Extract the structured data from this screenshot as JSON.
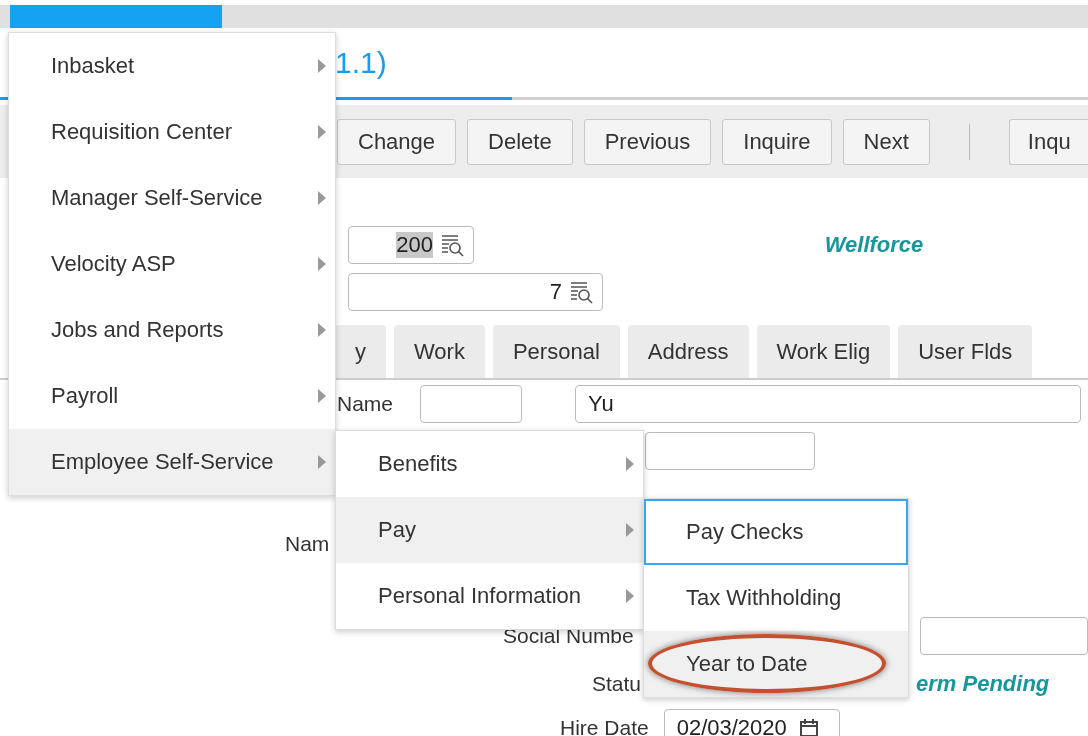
{
  "title_fragment": "1.1)",
  "toolbar": [
    "Change",
    "Delete",
    "Previous",
    "Inquire",
    "Next"
  ],
  "toolbar_cut": "Inqu",
  "company_field": {
    "value": "200"
  },
  "employee_field": {
    "value": "7"
  },
  "company_name": "Wellforce",
  "tabs": [
    {
      "label": "y",
      "selected": false
    },
    {
      "label": "Work",
      "selected": false
    },
    {
      "label": "Personal",
      "selected": false
    },
    {
      "label": "Address",
      "selected": false
    },
    {
      "label": "Work Elig",
      "selected": false
    },
    {
      "label": "User Flds",
      "selected": false
    }
  ],
  "form": {
    "name_label": "Name",
    "last_name": "Yu",
    "name_label_2": "Nam",
    "ssn_label": "Social Numbe",
    "status_label": "Statu",
    "status_text": "erm Pending",
    "hire_date_label": "Hire Date",
    "hire_date": "02/03/2020"
  },
  "menu": [
    {
      "label": "Inbasket",
      "selected": false
    },
    {
      "label": "Requisition Center",
      "selected": false
    },
    {
      "label": "Manager Self-Service",
      "selected": false
    },
    {
      "label": "Velocity ASP",
      "selected": false
    },
    {
      "label": "Jobs and Reports",
      "selected": false
    },
    {
      "label": "Payroll",
      "selected": false
    },
    {
      "label": "Employee Self-Service",
      "selected": true
    }
  ],
  "submenu": [
    {
      "label": "Benefits",
      "selected": false
    },
    {
      "label": "Pay",
      "selected": true
    },
    {
      "label": "Personal Information",
      "selected": false
    }
  ],
  "pay_menu": [
    {
      "label": "Pay Checks",
      "selected": false,
      "focused": true,
      "circled": false
    },
    {
      "label": "Tax Withholding",
      "selected": false,
      "focused": false,
      "circled": false
    },
    {
      "label": "Year to Date",
      "selected": true,
      "focused": false,
      "circled": true
    }
  ]
}
